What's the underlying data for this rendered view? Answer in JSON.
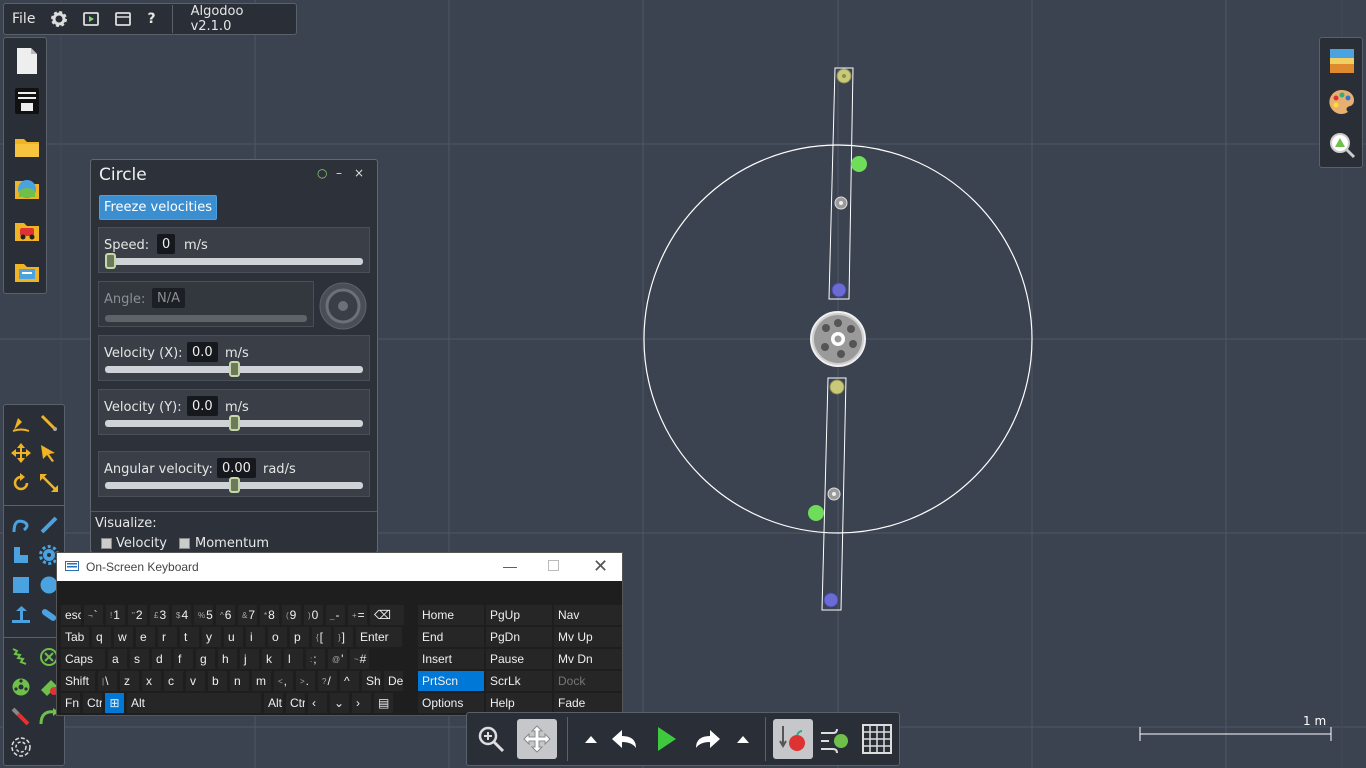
{
  "app": {
    "menu_file": "File",
    "title": "Algodoo v2.1.0",
    "help_glyph": "?"
  },
  "circle_panel": {
    "title": "Circle",
    "freeze_label": "Freeze velocities",
    "speed": {
      "label": "Speed:",
      "value": "0",
      "unit": "m/s",
      "slider_fraction": 0.0
    },
    "angle": {
      "label": "Angle:",
      "value": "N/A"
    },
    "velocity_x": {
      "label": "Velocity (X):",
      "value": "0.0",
      "unit": "m/s",
      "slider_fraction": 0.5
    },
    "velocity_y": {
      "label": "Velocity (Y):",
      "value": "0.0",
      "unit": "m/s",
      "slider_fraction": 0.5
    },
    "angular_velocity": {
      "label": "Angular velocity:",
      "value": "0.00",
      "unit": "rad/s",
      "slider_fraction": 0.5
    },
    "visualize_label": "Visualize:",
    "visualize_velocity": "Velocity",
    "visualize_momentum": "Momentum",
    "window_controls": {
      "pin": "○",
      "minimize": "–",
      "close": "×"
    }
  },
  "osk": {
    "title": "On-Screen Keyboard",
    "rows": [
      [
        {
          "t": "esc",
          "w": 20
        },
        {
          "s": "¬",
          "t": "`"
        },
        {
          "s": "!",
          "t": "1"
        },
        {
          "s": "\"",
          "t": "2"
        },
        {
          "s": "£",
          "t": "3"
        },
        {
          "s": "$",
          "t": "4"
        },
        {
          "s": "%",
          "t": "5"
        },
        {
          "s": "^",
          "t": "6"
        },
        {
          "s": "&",
          "t": "7"
        },
        {
          "s": "*",
          "t": "8"
        },
        {
          "s": "(",
          "t": "9"
        },
        {
          "s": ")",
          "t": "0"
        },
        {
          "s": "_",
          "t": "-"
        },
        {
          "s": "+",
          "t": "="
        },
        {
          "t": "⌫",
          "w": 34
        }
      ],
      [
        {
          "t": "Tab",
          "w": 28
        },
        {
          "t": "q"
        },
        {
          "t": "w"
        },
        {
          "t": "e"
        },
        {
          "t": "r"
        },
        {
          "t": "t"
        },
        {
          "t": "y"
        },
        {
          "t": "u"
        },
        {
          "t": "i"
        },
        {
          "t": "o"
        },
        {
          "t": "p"
        },
        {
          "s": "{",
          "t": "["
        },
        {
          "s": "}",
          "t": "]"
        },
        {
          "t": "Enter",
          "w": 46
        }
      ],
      [
        {
          "t": "Caps",
          "w": 44
        },
        {
          "t": "a"
        },
        {
          "t": "s"
        },
        {
          "t": "d"
        },
        {
          "t": "f"
        },
        {
          "t": "g"
        },
        {
          "t": "h"
        },
        {
          "t": "j"
        },
        {
          "t": "k"
        },
        {
          "t": "l"
        },
        {
          "s": ":",
          "t": ";"
        },
        {
          "s": "@",
          "t": "'"
        },
        {
          "s": "~",
          "t": "#"
        }
      ],
      [
        {
          "t": "Shift",
          "w": 34
        },
        {
          "s": "|",
          "t": "\\"
        },
        {
          "t": "z"
        },
        {
          "t": "x"
        },
        {
          "t": "c"
        },
        {
          "t": "v"
        },
        {
          "t": "b"
        },
        {
          "t": "n"
        },
        {
          "t": "m"
        },
        {
          "s": "<",
          "t": ","
        },
        {
          "s": ">",
          "t": "."
        },
        {
          "s": "?",
          "t": "/"
        },
        {
          "t": "^"
        },
        {
          "t": "Shi"
        },
        {
          "t": "Del"
        }
      ],
      [
        {
          "t": "Fn"
        },
        {
          "t": "Ctr"
        },
        {
          "t": "⊞",
          "sel": true
        },
        {
          "t": "Alt",
          "w": 134
        },
        {
          "t": "Alt"
        },
        {
          "t": "Ctr"
        },
        {
          "t": "‹"
        },
        {
          "t": "⌄"
        },
        {
          "t": "›"
        },
        {
          "t": "▤"
        }
      ]
    ],
    "nav_keys": [
      [
        "Home",
        "PgUp",
        "Nav"
      ],
      [
        "End",
        "PgDn",
        "Mv Up"
      ],
      [
        "Insert",
        "Pause",
        "Mv Dn"
      ],
      [
        "PrtScn",
        "ScrLk",
        "Dock"
      ],
      [
        "Options",
        "Help",
        "Fade"
      ]
    ]
  },
  "scale_label": "1 m",
  "colors": {
    "background": "#3b4250",
    "grid": "#4d5462",
    "panel": "#2a2f37",
    "accent_blue": "#3b8fd1",
    "osk_selected": "#0078d7",
    "pin_yellow": "#c9c97a",
    "pin_green": "#6fdc5a",
    "pin_blue": "#6b6bd4"
  }
}
